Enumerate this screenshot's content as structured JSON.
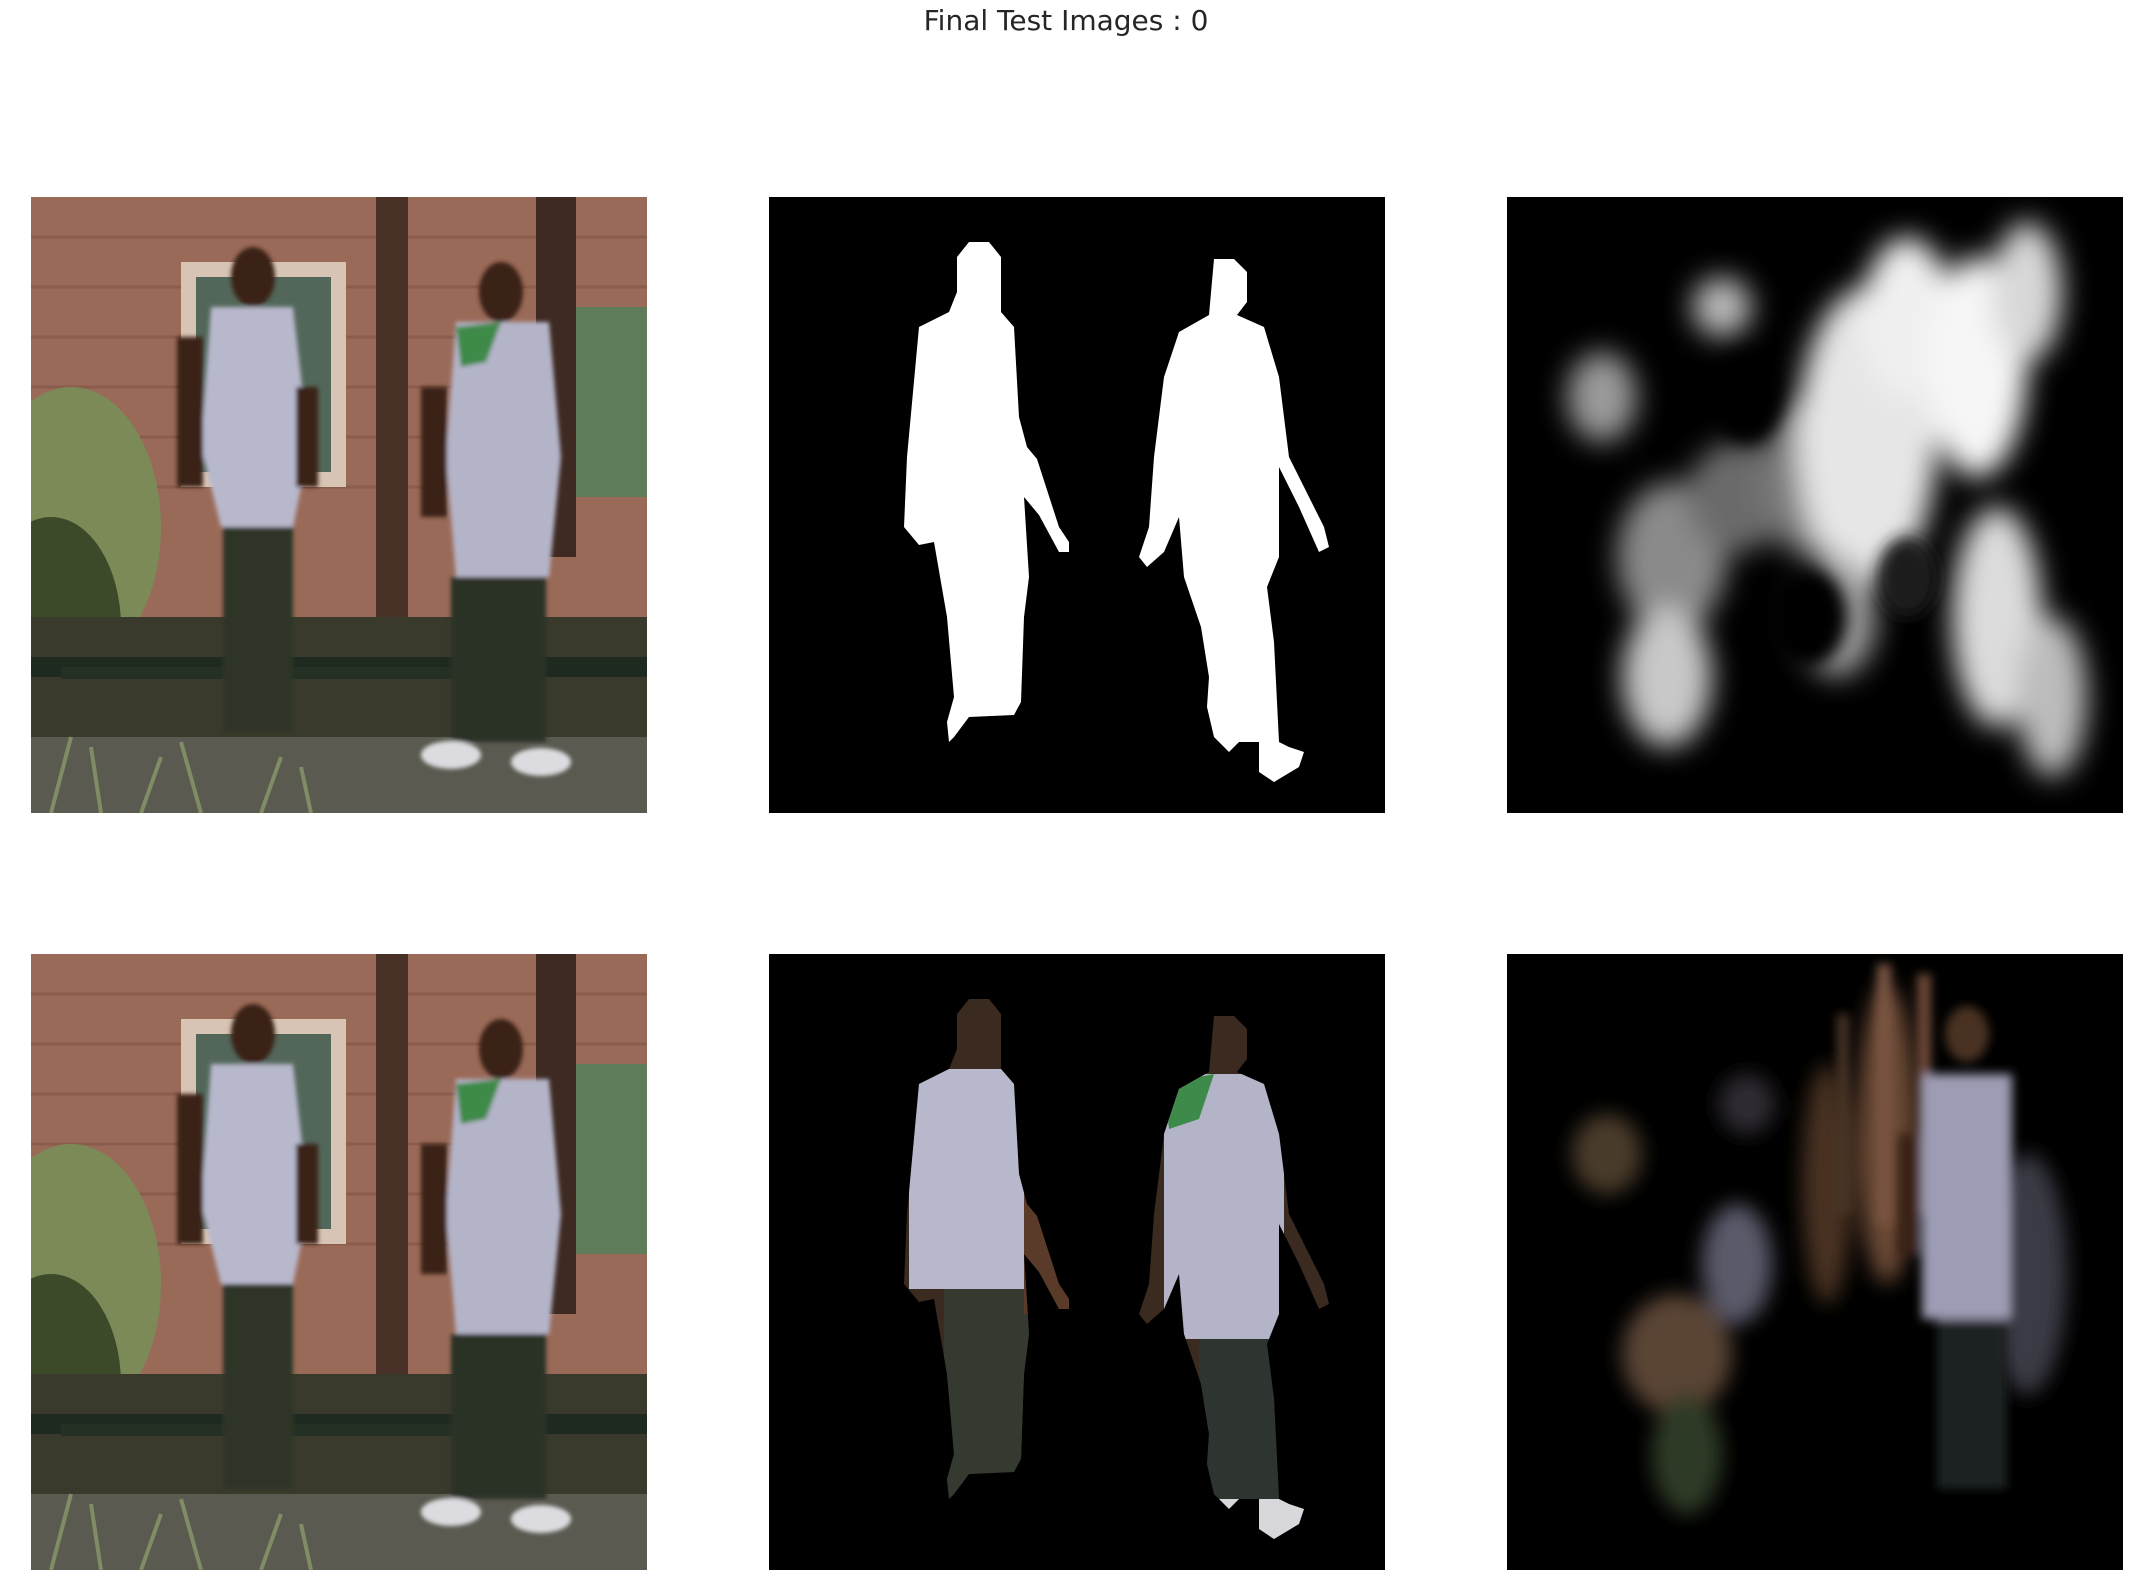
{
  "figure": {
    "title": "Final Test Images : 0"
  },
  "panels": [
    {
      "row": 1,
      "col": 1,
      "content": "photo of two men walking"
    },
    {
      "row": 1,
      "col": 2,
      "content": "white silhouette mask on black"
    },
    {
      "row": 1,
      "col": 3,
      "content": "blurry grayscale predicted mask"
    },
    {
      "row": 2,
      "col": 1,
      "content": "photo of two men walking"
    },
    {
      "row": 2,
      "col": 2,
      "content": "men cut out on black"
    },
    {
      "row": 2,
      "col": 3,
      "content": "dark blurry predicted cutout"
    }
  ]
}
